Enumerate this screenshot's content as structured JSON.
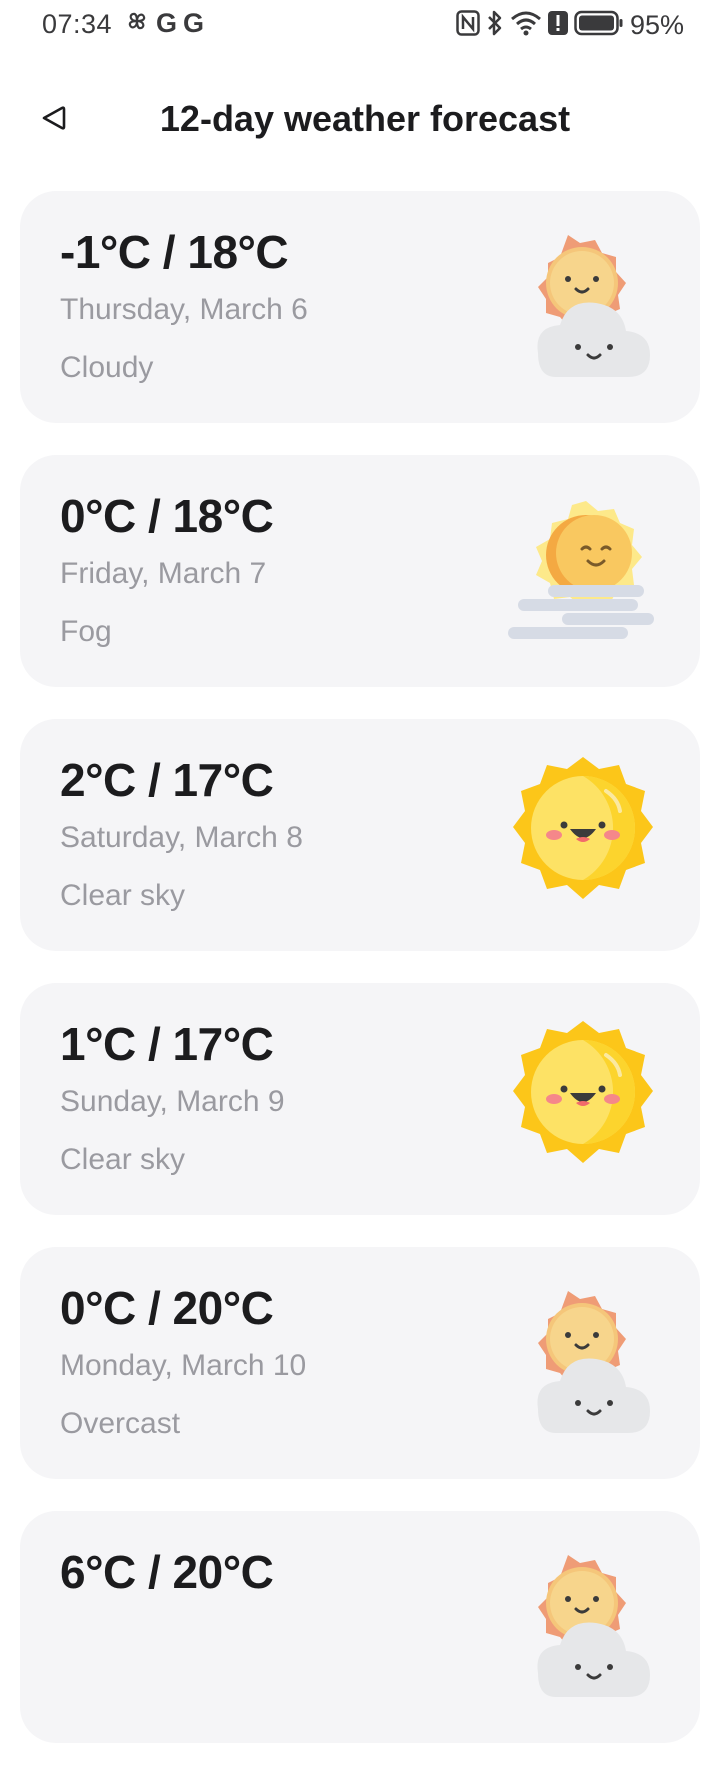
{
  "status_bar": {
    "time": "07:34",
    "left_icons": [
      "pinwheel-icon",
      "G",
      "G"
    ],
    "right_icons": [
      "nfc-icon",
      "bluetooth-icon",
      "wifi-icon",
      "alert-icon",
      "battery-icon"
    ],
    "battery_text": "95%"
  },
  "header": {
    "title": "12-day weather forecast",
    "back_icon": "back-triangle-icon"
  },
  "forecast": [
    {
      "temp": "-1°C / 18°C",
      "date": "Thursday, March 6",
      "condition": "Cloudy",
      "icon": "sun-cloud-icon"
    },
    {
      "temp": "0°C / 18°C",
      "date": "Friday, March 7",
      "condition": "Fog",
      "icon": "sun-fog-icon"
    },
    {
      "temp": "2°C / 17°C",
      "date": "Saturday, March 8",
      "condition": "Clear sky",
      "icon": "happy-sun-icon"
    },
    {
      "temp": "1°C / 17°C",
      "date": "Sunday, March 9",
      "condition": "Clear sky",
      "icon": "happy-sun-icon"
    },
    {
      "temp": "0°C / 20°C",
      "date": "Monday, March 10",
      "condition": "Overcast",
      "icon": "sun-cloud-icon"
    },
    {
      "temp": "6°C / 20°C",
      "date": "",
      "condition": "",
      "icon": "sun-cloud-icon"
    }
  ],
  "colors": {
    "card_bg": "#f5f5f7",
    "secondary_text": "#9a9aa0",
    "sun_yellow": "#fcd116",
    "sun_orange": "#f0a07a",
    "cloud_gray": "#e7e8ea"
  }
}
